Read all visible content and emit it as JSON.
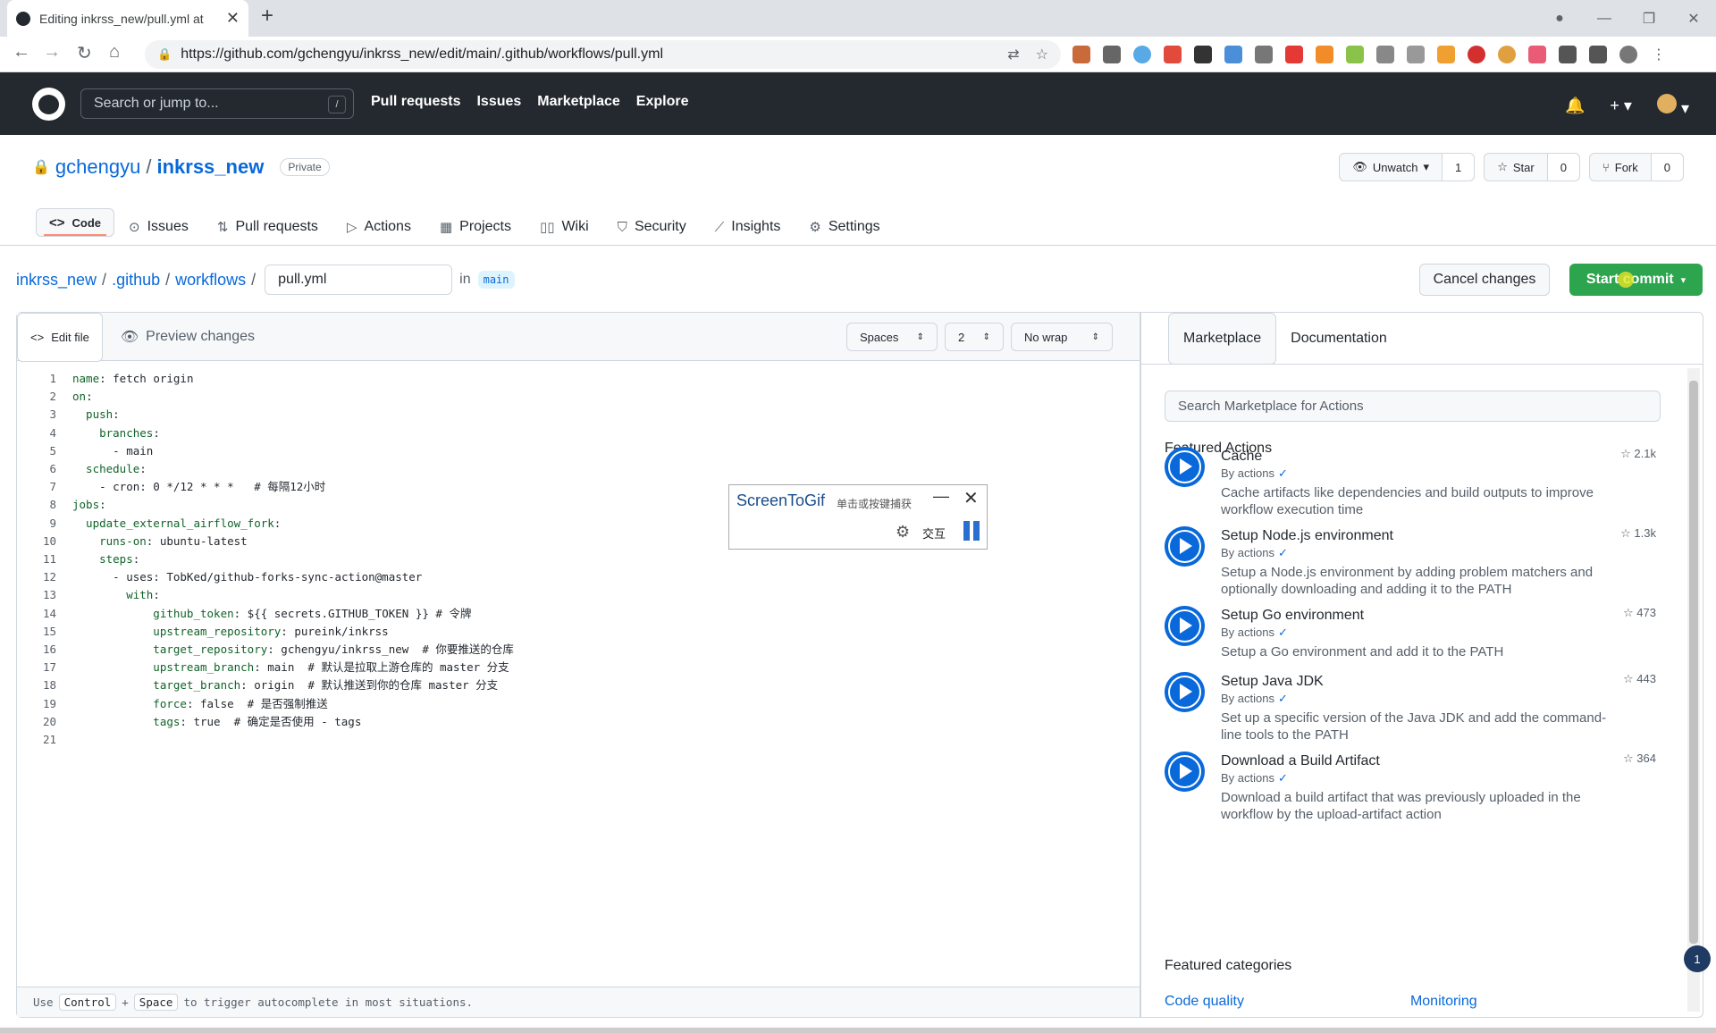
{
  "browser": {
    "tab_title": "Editing inkrss_new/pull.yml at",
    "url": "https://github.com/gchengyu/inkrss_new/edit/main/.github/workflows/pull.yml"
  },
  "gh": {
    "search_placeholder": "Search or jump to...",
    "search_key": "/",
    "nav": [
      "Pull requests",
      "Issues",
      "Marketplace",
      "Explore"
    ]
  },
  "repo": {
    "owner": "gchengyu",
    "name": "inkrss_new",
    "visibility": "Private",
    "unwatch_label": "Unwatch",
    "unwatch_count": "1",
    "star_label": "Star",
    "star_count": "0",
    "fork_label": "Fork",
    "fork_count": "0",
    "tabs": [
      "Code",
      "Issues",
      "Pull requests",
      "Actions",
      "Projects",
      "Wiki",
      "Security",
      "Insights",
      "Settings"
    ]
  },
  "breadcrumb": {
    "root": "inkrss_new",
    "dir1": ".github",
    "dir2": "workflows",
    "file": "pull.yml",
    "in": "in",
    "branch": "main"
  },
  "actions": {
    "cancel": "Cancel changes",
    "commit": "Start commit"
  },
  "editor": {
    "tab_edit": "Edit file",
    "tab_preview": "Preview changes",
    "indent_mode": "Spaces",
    "indent_size": "2",
    "wrap_mode": "No wrap",
    "lines": [
      [
        "name",
        ": fetch origin"
      ],
      [
        "on",
        ":"
      ],
      [
        "  push",
        ":"
      ],
      [
        "    branches",
        ":"
      ],
      [
        "",
        "      - main"
      ],
      [
        "  schedule",
        ":"
      ],
      [
        "",
        "    - cron: 0 */12 * * *   # 每隔12小时"
      ],
      [
        "jobs",
        ":"
      ],
      [
        "  update_external_airflow_fork",
        ":"
      ],
      [
        "    runs-on",
        ": ubuntu-latest"
      ],
      [
        "    steps",
        ":"
      ],
      [
        "",
        "      - uses: TobKed/github-forks-sync-action@master"
      ],
      [
        "        with",
        ":"
      ],
      [
        "            github_token",
        ": ${{ secrets.GITHUB_TOKEN }} # 令牌"
      ],
      [
        "            upstream_repository",
        ": pureink/inkrss"
      ],
      [
        "            target_repository",
        ": gchengyu/inkrss_new  # 你要推送的仓库"
      ],
      [
        "            upstream_branch",
        ": main  # 默认是拉取上游仓库的 master 分支"
      ],
      [
        "            target_branch",
        ": origin  # 默认推送到你的仓库 master 分支"
      ],
      [
        "            force",
        ": false  # 是否强制推送"
      ],
      [
        "            tags",
        ": true  # 确定是否使用 - tags"
      ],
      [
        "",
        ""
      ]
    ],
    "footer_use": "Use",
    "footer_key1": "Control",
    "footer_plus": "+",
    "footer_key2": "Space",
    "footer_rest": "to trigger autocomplete in most situations."
  },
  "screentogif": {
    "title": "ScreenToGif",
    "subtitle": "单击或按键捕获",
    "mode": "交互"
  },
  "sidebar": {
    "tab_marketplace": "Marketplace",
    "tab_docs": "Documentation",
    "search_placeholder": "Search Marketplace for Actions",
    "featured_title": "Featured Actions",
    "by": "By actions",
    "items": [
      {
        "name": "Cache",
        "stars": "2.1k",
        "desc": "Cache artifacts like dependencies and build outputs to improve workflow execution time"
      },
      {
        "name": "Setup Node.js environment",
        "stars": "1.3k",
        "desc": "Setup a Node.js environment by adding problem matchers and optionally downloading and adding it to the PATH"
      },
      {
        "name": "Setup Go environment",
        "stars": "473",
        "desc": "Setup a Go environment and add it to the PATH"
      },
      {
        "name": "Setup Java JDK",
        "stars": "443",
        "desc": "Set up a specific version of the Java JDK and add the command-line tools to the PATH"
      },
      {
        "name": "Download a Build Artifact",
        "stars": "364",
        "desc": "Download a build artifact that was previously uploaded in the workflow by the upload-artifact action"
      }
    ],
    "categories_title": "Featured categories",
    "categories": [
      "Code quality",
      "Monitoring"
    ],
    "notif_count": "1"
  }
}
